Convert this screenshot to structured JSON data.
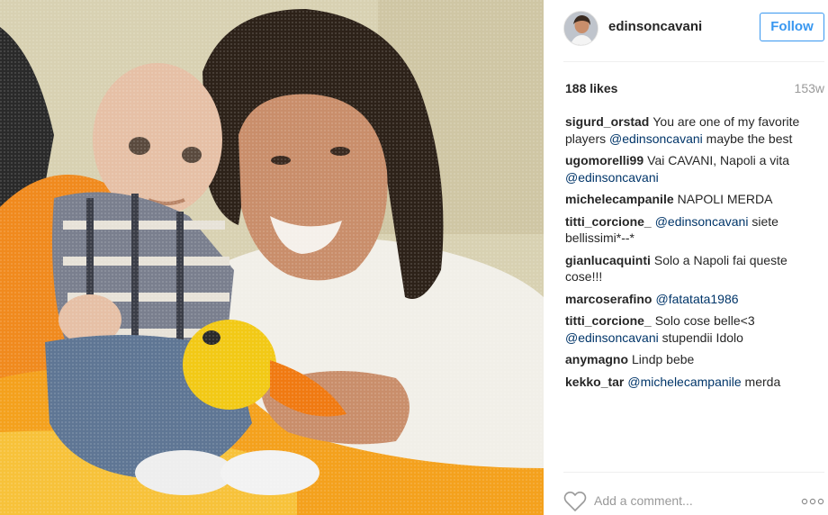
{
  "post": {
    "username": "edinsoncavani",
    "follow_label": "Follow",
    "likes": "188 likes",
    "time_ago": "153w",
    "comment_placeholder": "Add a comment...",
    "icons": {
      "avatar": "profile-avatar",
      "like": "heart-icon",
      "more": "more-options-icon"
    },
    "colors": {
      "follow_accent": "#3897f0",
      "mention": "#003569",
      "muted": "#999999"
    }
  },
  "comments": [
    {
      "user": "sigurd_orstad",
      "parts": [
        {
          "t": "text",
          "v": "You are one of my favorite players "
        },
        {
          "t": "mention",
          "v": "@edinsoncavani"
        },
        {
          "t": "text",
          "v": " maybe the best"
        }
      ]
    },
    {
      "user": "ugomorelli99",
      "parts": [
        {
          "t": "text",
          "v": "Vai CAVANI, Napoli a vita "
        },
        {
          "t": "mention",
          "v": "@edinsoncavani"
        }
      ]
    },
    {
      "user": "michelecampanile",
      "parts": [
        {
          "t": "text",
          "v": "NAPOLI MERDA"
        }
      ]
    },
    {
      "user": "titti_corcione_",
      "parts": [
        {
          "t": "mention",
          "v": "@edinsoncavani"
        },
        {
          "t": "text",
          "v": " siete bellissimi*--*"
        }
      ]
    },
    {
      "user": "gianlucaquinti",
      "parts": [
        {
          "t": "text",
          "v": "Solo a Napoli fai queste cose!!!"
        }
      ]
    },
    {
      "user": "marcoserafino",
      "parts": [
        {
          "t": "mention",
          "v": "@fatatata1986"
        }
      ]
    },
    {
      "user": "titti_corcione_",
      "parts": [
        {
          "t": "text",
          "v": "Solo cose belle<3 "
        },
        {
          "t": "mention",
          "v": "@edinsoncavani"
        },
        {
          "t": "text",
          "v": " stupendii Idolo"
        }
      ]
    },
    {
      "user": "anymagno",
      "parts": [
        {
          "t": "text",
          "v": "Lindp bebe"
        }
      ]
    },
    {
      "user": "kekko_tar",
      "parts": [
        {
          "t": "mention",
          "v": "@michelecampanile"
        },
        {
          "t": "text",
          "v": " merda"
        }
      ]
    }
  ]
}
